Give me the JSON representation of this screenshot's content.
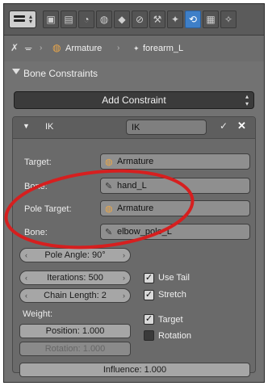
{
  "header": {
    "tabs": [
      "render-icon",
      "layers-icon",
      "scene-icon",
      "world-icon",
      "object-icon",
      "constraint-icon",
      "modifier-icon",
      "data-icon",
      "bone-icon",
      "bone-constraint-icon",
      "texture-icon",
      "particle-icon"
    ]
  },
  "breadcrumb": {
    "armature": "Armature",
    "bone": "forearm_L",
    "separator": "›"
  },
  "panel": {
    "title": "Bone Constraints",
    "add_button": "Add Constraint"
  },
  "constraint": {
    "type_label": "IK",
    "name": "IK",
    "target_label": "Target:",
    "target_value": "Armature",
    "bone_label": "Bone:",
    "bone_value": "hand_L",
    "pole_target_label": "Pole Target:",
    "pole_target_value": "Armature",
    "pole_bone_label": "Bone:",
    "pole_bone_value": "elbow_pole_L",
    "pole_angle": "Pole Angle: 90°",
    "iterations": "Iterations: 500",
    "chain_length": "Chain Length: 2",
    "use_tail_label": "Use Tail",
    "use_tail": true,
    "stretch_label": "Stretch",
    "stretch": true,
    "weight_label": "Weight:",
    "position": "Position: 1.000",
    "rotation_weight": "Rotation: 1.000",
    "target_check_label": "Target",
    "target_check": true,
    "rotation_check_label": "Rotation",
    "rotation_check": false,
    "influence": "Influence: 1.000"
  },
  "colors": {
    "accent_blue": "#3e7fc8",
    "annotation_red": "#d61f1f",
    "panel_bg": "#727272"
  }
}
